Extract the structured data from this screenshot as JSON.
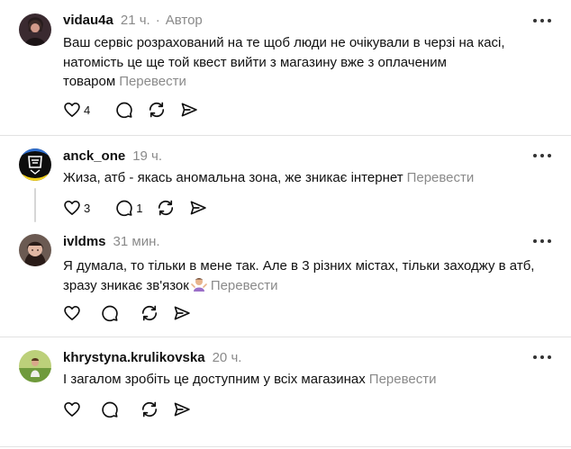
{
  "common": {
    "translate_label": "Перевести"
  },
  "posts": [
    {
      "username": "vidau4a",
      "time": "21 ч.",
      "separator": "·",
      "author_badge": "Автор",
      "text": "Ваш сервіс розрахований на те щоб люди не очікували в черзі на касі, натомість це ще той квест вийти з магазину вже з оплаченим товаром",
      "likes": "4",
      "replies": ""
    },
    {
      "username": "anck_one",
      "time": "19 ч.",
      "text": "Жиза, атб - якась аномальна зона, же зникає інтернет",
      "likes": "3",
      "replies": "1"
    },
    {
      "username": "ivldms",
      "time": "31 мин.",
      "text": "Я думала, то тільки в мене так. Але в 3 різних містах, тільки заходжу в атб, зразу зникає зв'язок",
      "likes": "",
      "replies": ""
    },
    {
      "username": "khrystyna.krulikovska",
      "time": "20 ч.",
      "text": "І загалом зробіть це доступним у всіх магазинах",
      "likes": "",
      "replies": ""
    }
  ]
}
